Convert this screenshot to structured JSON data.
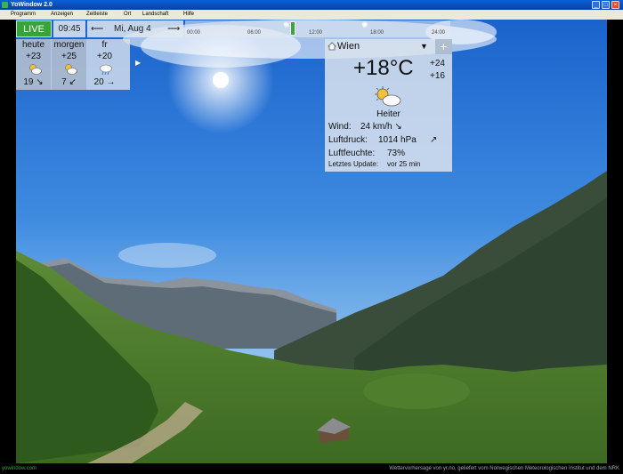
{
  "window": {
    "title": "YoWindow 2.0"
  },
  "menu": [
    "Programm",
    "Anzeigen",
    "Zeitleiste",
    "Ort",
    "Landschaft",
    "Hilfe"
  ],
  "live_label": "LIVE",
  "time": "09:45",
  "date": {
    "prev": "⟵",
    "label": "Mi, Aug 4",
    "next": "⟶"
  },
  "timeline": {
    "ticks": [
      "00:00",
      "06:00",
      "12:00",
      "18:00",
      "24:00"
    ]
  },
  "forecast": [
    {
      "name": "heute",
      "hi": "+23",
      "lo": "19 ↘",
      "icon": "sun-cloud-icon"
    },
    {
      "name": "morgen",
      "hi": "+25",
      "lo": "7 ↙",
      "icon": "sun-cloud-icon"
    },
    {
      "name": "fr",
      "hi": "+20",
      "lo": "20 →",
      "icon": "rain-cloud-icon"
    }
  ],
  "forecast_more": "▶",
  "current": {
    "city": "Wien",
    "temp": "+18°C",
    "hi": "+24",
    "lo": "+16",
    "condition": "Heiter",
    "wind_label": "Wind:",
    "wind_value": "24 km/h  ↘",
    "pressure_label": "Luftdruck:",
    "pressure_value": "1014 hPa",
    "pressure_trend": "↗",
    "humidity_label": "Luftfeuchte:",
    "humidity_value": "73%",
    "update_label": "Letztes Update:",
    "update_value": "vor 25 min",
    "add": "+",
    "dropdown": "▼"
  },
  "status": {
    "site": "yowindow.com",
    "credit": "Wettervorhersage von yr.no, geliefert vom Norwegischen Meteorologischen Institut und dem NRK"
  },
  "colors": {
    "live": "#38a338",
    "sky_top": "#1c6bd1",
    "sky_bottom": "#8fc0ee",
    "grass": "#5c8a35"
  }
}
